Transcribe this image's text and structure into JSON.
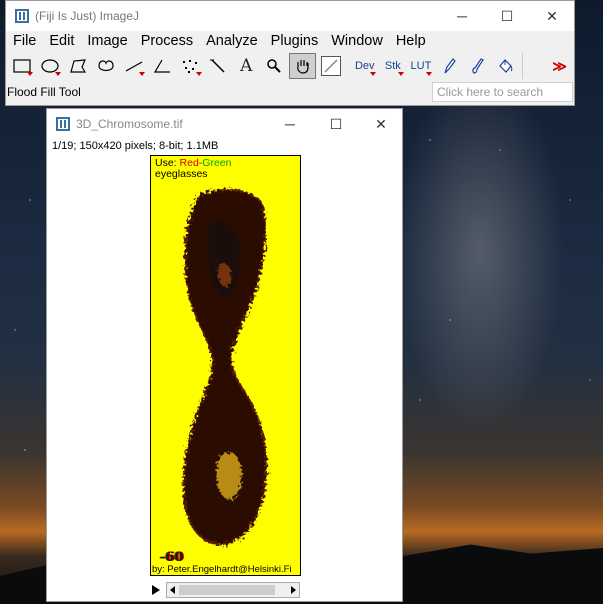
{
  "main_window": {
    "title": "(Fiji Is Just) ImageJ",
    "menu": [
      "File",
      "Edit",
      "Image",
      "Process",
      "Analyze",
      "Plugins",
      "Window",
      "Help"
    ],
    "tools": [
      {
        "name": "rectangle-tool",
        "icon": "rectangle-icon"
      },
      {
        "name": "oval-tool",
        "icon": "oval-icon"
      },
      {
        "name": "polygon-tool",
        "icon": "polygon-icon"
      },
      {
        "name": "freehand-tool",
        "icon": "freehand-icon"
      },
      {
        "name": "line-tool",
        "icon": "line-icon"
      },
      {
        "name": "angle-tool",
        "icon": "angle-icon"
      },
      {
        "name": "point-tool",
        "icon": "multipoint-icon"
      },
      {
        "name": "wand-tool",
        "icon": "wand-icon"
      },
      {
        "name": "text-tool",
        "icon": "text-icon",
        "label": "A"
      },
      {
        "name": "magnifier-tool",
        "icon": "magnifier-icon"
      },
      {
        "name": "hand-tool",
        "icon": "hand-icon"
      },
      {
        "name": "color-picker-tool",
        "icon": "dropper-icon"
      },
      {
        "name": "dev-menu",
        "label": "Dev"
      },
      {
        "name": "stk-menu",
        "label": "Stk"
      },
      {
        "name": "lut-menu",
        "label": "LUT"
      },
      {
        "name": "pencil-tool",
        "icon": "pencil-icon"
      },
      {
        "name": "brush-tool",
        "icon": "brush-icon"
      },
      {
        "name": "flood-fill-tool",
        "icon": "bucket-icon"
      },
      {
        "name": "more-tools",
        "label": "≫"
      }
    ],
    "status": "Flood Fill Tool",
    "search_placeholder": "Click here to search",
    "window_controls": {
      "minimize": "─",
      "maximize": "☐",
      "close": "✕"
    }
  },
  "image_window": {
    "title": "3D_Chromosome.tif",
    "info": "1/19; 150x420 pixels; 8-bit; 1.1MB",
    "canvas": {
      "use_label": "Use:",
      "red_label": "Red",
      "dash": "-",
      "green_label": "Green",
      "line2": "eyeglasses",
      "number": "-60",
      "credit": "by: Peter.Engelhardt@Helsinki.Fi"
    },
    "window_controls": {
      "minimize": "─",
      "maximize": "☐",
      "close": "✕"
    }
  },
  "colors": {
    "canvas_bg": "#ffff00",
    "accent_red": "#d40000",
    "accent_green": "#00a400"
  }
}
